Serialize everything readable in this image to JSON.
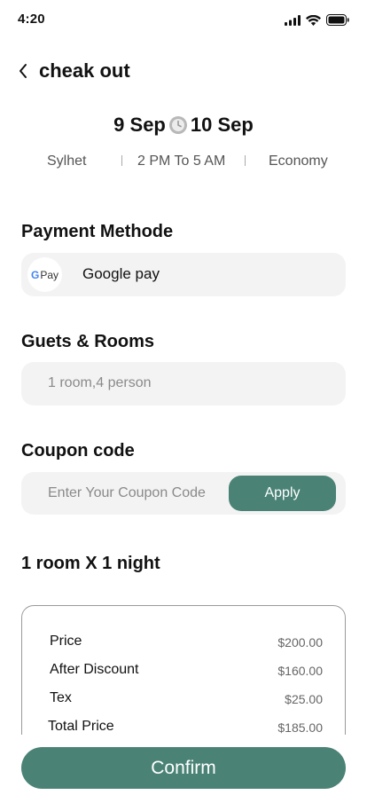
{
  "status_bar": {
    "time": "4:20"
  },
  "header": {
    "title": "cheak out"
  },
  "dates": {
    "from": "9 Sep",
    "to": "10 Sep"
  },
  "meta": {
    "location": "Sylhet",
    "time_range": "2 PM To 5 AM",
    "class": "Economy"
  },
  "payment": {
    "label": "Payment Methode",
    "badge_g": "G",
    "badge_pay": "Pay",
    "value": "Google pay"
  },
  "guests": {
    "label": "Guets & Rooms",
    "placeholder": "1 room,4 person"
  },
  "coupon": {
    "label": "Coupon code",
    "placeholder": "Enter Your Coupon Code",
    "apply_label": "Apply"
  },
  "summary": {
    "title": "1 room X 1 night",
    "rows": [
      {
        "label": "Price",
        "value": "$200.00"
      },
      {
        "label": "After Discount",
        "value": "$160.00"
      },
      {
        "label": "Tex",
        "value": "$25.00"
      },
      {
        "label": "Total Price",
        "value": "$185.00"
      }
    ]
  },
  "confirm_label": "Confirm",
  "colors": {
    "accent": "#4a8375",
    "field_bg": "#f3f3f3"
  },
  "icons": {
    "back": "chevron-left-icon",
    "clock": "clock-icon",
    "signal": "signal-icon",
    "wifi": "wifi-icon",
    "battery": "battery-icon"
  }
}
